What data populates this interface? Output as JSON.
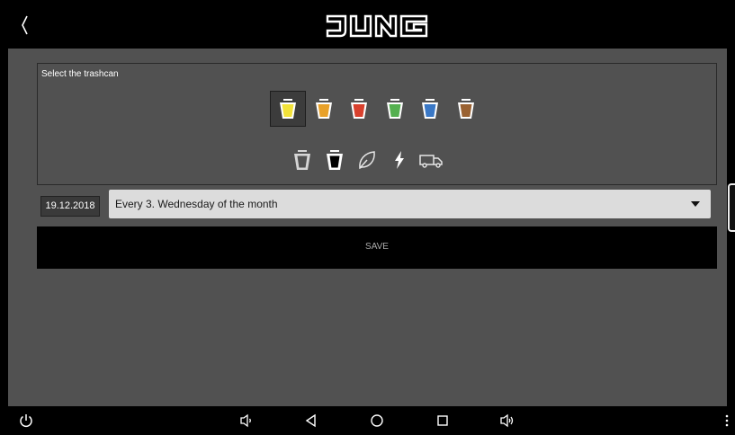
{
  "header": {
    "back_icon": "chevron-left-icon",
    "logo_text": "JUNG"
  },
  "trash_selector": {
    "title": "Select the trashcan",
    "selected": "yellow",
    "color_bins": [
      {
        "name": "yellow",
        "color": "#f2e23a"
      },
      {
        "name": "orange",
        "color": "#e8a12a"
      },
      {
        "name": "red",
        "color": "#d8402d"
      },
      {
        "name": "green",
        "color": "#55b050"
      },
      {
        "name": "blue",
        "color": "#3a78c6"
      },
      {
        "name": "brown",
        "color": "#9a6232"
      }
    ],
    "type_icons": [
      "gray-bin-icon",
      "black-bin-icon",
      "leaf-icon",
      "lightning-icon",
      "truck-icon"
    ]
  },
  "schedule": {
    "date": "19.12.2018",
    "recurrence": "Every 3. Wednesday of the month"
  },
  "save_button": {
    "label": "SAVE"
  },
  "navbar": {
    "icons": [
      "power-icon",
      "volume-down-icon",
      "back-triangle-icon",
      "home-circle-icon",
      "recents-square-icon",
      "volume-up-icon",
      "more-vert-icon"
    ]
  }
}
